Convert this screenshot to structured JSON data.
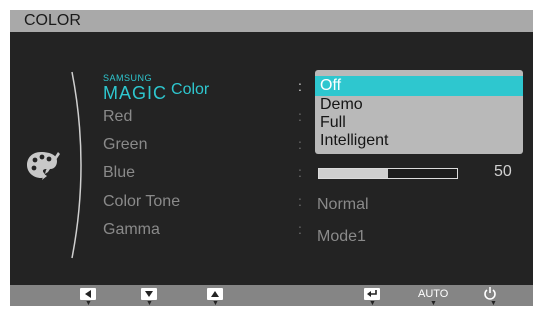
{
  "menu": {
    "title": "COLOR",
    "items": [
      {
        "label": "Color"
      },
      {
        "label": "Red"
      },
      {
        "label": "Green"
      },
      {
        "label": "Blue"
      },
      {
        "label": "Color Tone"
      },
      {
        "label": "Gamma"
      }
    ],
    "brand": {
      "top": "SAMSUNG",
      "bottom": "MAGIC"
    },
    "separator": ":"
  },
  "color_dropdown": {
    "options": [
      "Off",
      "Demo",
      "Full",
      "Intelligent"
    ],
    "selected": "Off"
  },
  "blue_slider": {
    "value": 50,
    "max": 100,
    "value_label": "50"
  },
  "color_tone": {
    "value": "Normal"
  },
  "gamma": {
    "value": "Mode1"
  },
  "buttons": {
    "auto_label": "AUTO",
    "arrow_glyph": "▼"
  },
  "icons": {
    "category": "palette-brush-icon",
    "left": "left-arrow-icon",
    "down": "down-arrow-icon",
    "up": "up-arrow-icon",
    "enter": "enter-icon",
    "power": "power-icon"
  },
  "colors": {
    "accent": "#2ec7cf",
    "background": "#232323",
    "titlebar": "#a9a9a9",
    "dropdown": "#b9b9b9"
  }
}
